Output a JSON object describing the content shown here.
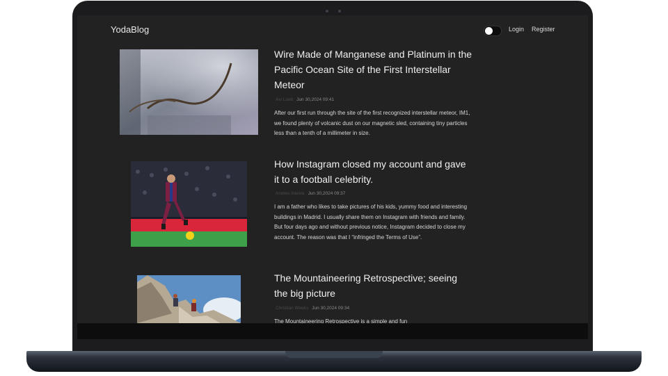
{
  "nav": {
    "brand": "YodaBlog",
    "login": "Login",
    "register": "Register"
  },
  "posts": [
    {
      "title": "Wire Made of Manganese and Platinum in the Pacific Ocean Site of the First Interstellar Meteor",
      "author": "Avi Loeb",
      "date": "Jun 30,2024 09:41",
      "excerpt": "After our first run through the site of the first recognized interstellar meteor, IM1, we found plenty of volcanic dust on our magnetic sled, containing tiny particles less than a tenth of a millimeter in size."
    },
    {
      "title": "How Instagram closed my account and gave it to a football celebrity.",
      "author": "Andres Iniesta",
      "date": "Jun 30,2024 09:37",
      "excerpt": "I am a father who likes to take pictures of his kids, yummy food and interesting buildings in Madrid. I usually share them on Instagram with friends and family. But four days ago and without previous notice, Instagram decided to close my account. The reason was that I “infringed the Terms of Use”."
    },
    {
      "title": "The Mountaineering Retrospective; seeing the big picture",
      "author": "Christian Weeks",
      "date": "Jun 30,2024 09:34",
      "excerpt": "The Mountaineering Retrospective is a simple and fun"
    }
  ]
}
